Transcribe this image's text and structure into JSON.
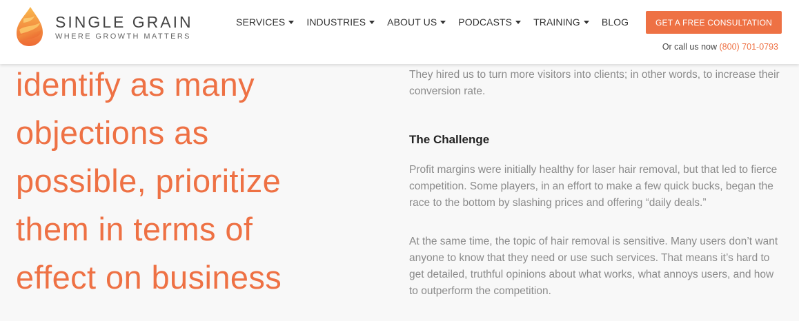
{
  "header": {
    "logo": {
      "name": "SINGLE GRAIN",
      "tagline": "WHERE GROWTH MATTERS",
      "icon": "single-grain-drop-logo",
      "colors": [
        "#f8b04a",
        "#f07c3e",
        "#e85a2f"
      ]
    },
    "nav": [
      {
        "label": "SERVICES",
        "dropdown": true
      },
      {
        "label": "INDUSTRIES",
        "dropdown": true
      },
      {
        "label": "ABOUT US",
        "dropdown": true
      },
      {
        "label": "PODCASTS",
        "dropdown": true
      },
      {
        "label": "TRAINING",
        "dropdown": true
      },
      {
        "label": "BLOG",
        "dropdown": false
      }
    ],
    "cta_label": "GET A FREE CONSULTATION",
    "call_text": "Or call us now",
    "phone": "(800) 701-0793"
  },
  "quote": {
    "lines": [
      "identify as many",
      "objections as",
      "possible, prioritize",
      "them in terms of",
      "effect on business"
    ]
  },
  "article": {
    "intro": "They hired us to turn more visitors into clients; in other words, to increase their conversion rate.",
    "challenge_heading": "The Challenge",
    "p1": "Profit margins were initially healthy for laser hair removal, but that led to fierce competition. Some players, in an effort to make a few quick bucks, began the race to the bottom by slashing prices and offering “daily deals.”",
    "p2": "At the same time, the topic of hair removal is sensitive. Many users don’t want anyone to know that they need or use such services. That means it’s hard to get detailed, truthful opinions about what works, what annoys users, and how to outperform the competition."
  },
  "colors": {
    "accent": "#ee7144",
    "body_text": "#8a8a8a",
    "heading_text": "#222222",
    "background": "#f8f8f8"
  }
}
